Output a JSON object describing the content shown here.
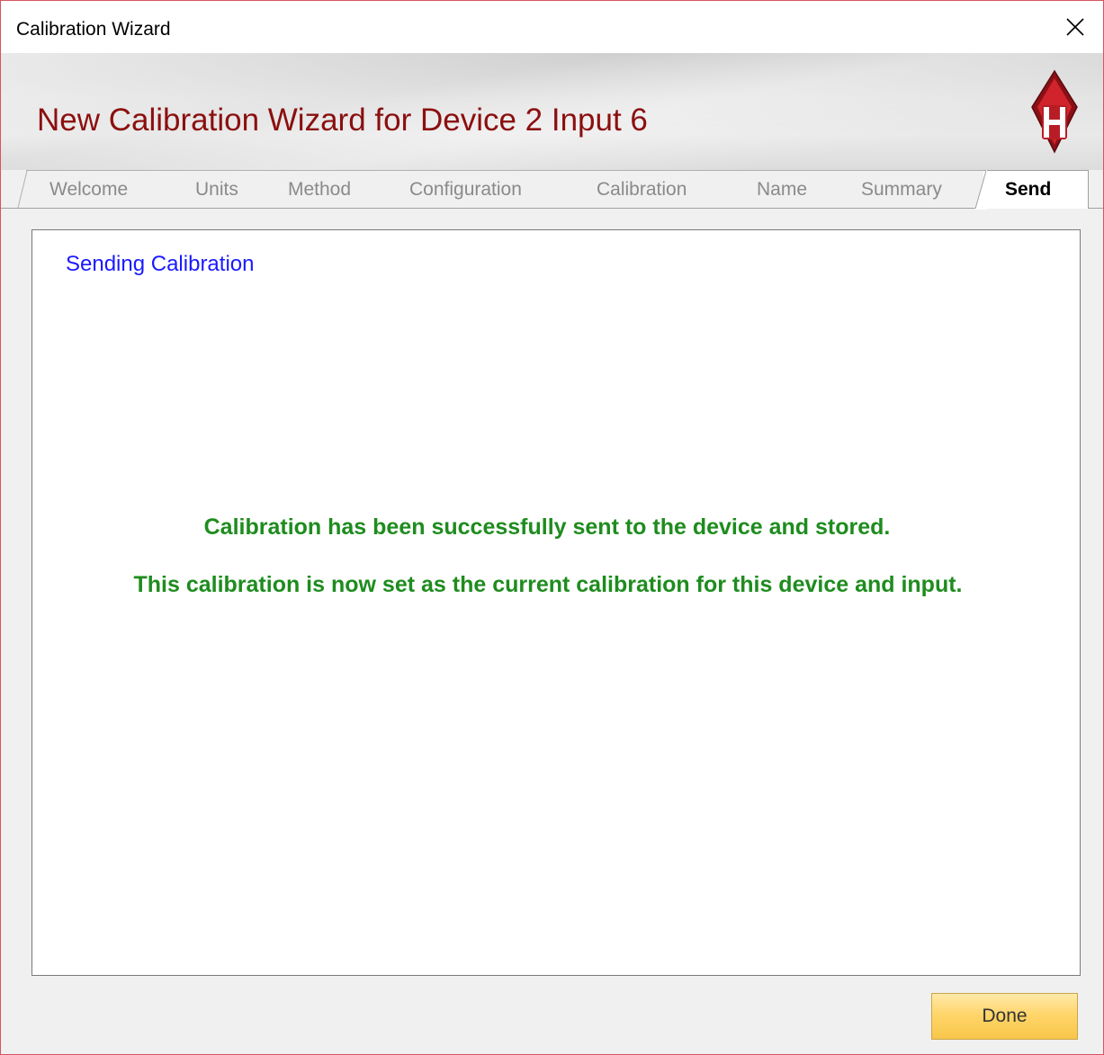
{
  "window": {
    "title": "Calibration Wizard",
    "close_icon": "close-icon"
  },
  "banner": {
    "title": "New Calibration Wizard for Device 2 Input 6",
    "logo_letter": "H",
    "logo_color": "#c8202a",
    "title_color": "#8b0f0f"
  },
  "tabs": [
    {
      "label": "Welcome",
      "active": false
    },
    {
      "label": "Units",
      "active": false
    },
    {
      "label": "Method",
      "active": false
    },
    {
      "label": "Configuration",
      "active": false
    },
    {
      "label": "Calibration",
      "active": false
    },
    {
      "label": "Name",
      "active": false
    },
    {
      "label": "Summary",
      "active": false
    },
    {
      "label": "Send",
      "active": true
    }
  ],
  "content": {
    "heading": "Sending Calibration",
    "message_1": "Calibration has been successfully sent to the device and stored.",
    "message_2": "This calibration is now set as the current calibration for this device and input.",
    "heading_color": "#1a1aff",
    "message_color": "#1e8c1e"
  },
  "footer": {
    "done_label": "Done"
  }
}
